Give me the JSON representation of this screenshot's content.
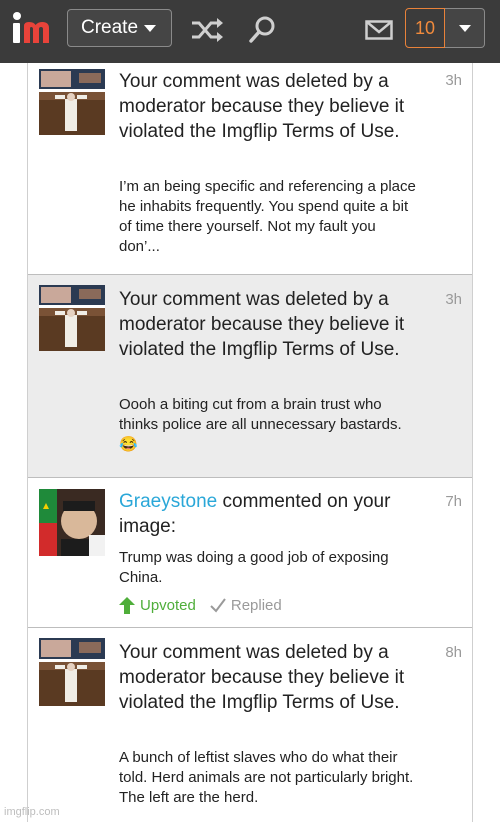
{
  "header": {
    "create_label": "Create",
    "notification_count": "10"
  },
  "notifications": [
    {
      "message": "Your comment was deleted by a moderator because they believe it violated the Imgflip Terms of Use.",
      "time": "3h",
      "preview": "I’m an being specific and referencing a place he inhabits frequently. You spend quite a bit of time there yourself. Not my fault you don’..."
    },
    {
      "message": "Your comment was deleted by a moderator because they believe it violated the Imgflip Terms of Use.",
      "time": "3h",
      "preview": "Oooh a biting cut from a brain trust who thinks police are all unnecessary bastards. 😂"
    },
    {
      "username": "Graeystone",
      "message_rest": " commented on your image:",
      "time": "7h",
      "preview": "Trump was doing a good job of exposing China.",
      "upvoted_label": "Upvoted",
      "replied_label": "Replied"
    },
    {
      "message": "Your comment was deleted by a moderator because they believe it violated the Imgflip Terms of Use.",
      "time": "8h",
      "preview": "A bunch of leftist slaves who do what their told. Herd animals are not particularly bright. The left are the herd."
    }
  ],
  "watermark": "imgflip.com",
  "colors": {
    "topbar": "#3b3b3b",
    "accent_orange": "#f08a3c",
    "username_blue": "#2aa7d8",
    "upvote_green": "#4fae3a"
  }
}
